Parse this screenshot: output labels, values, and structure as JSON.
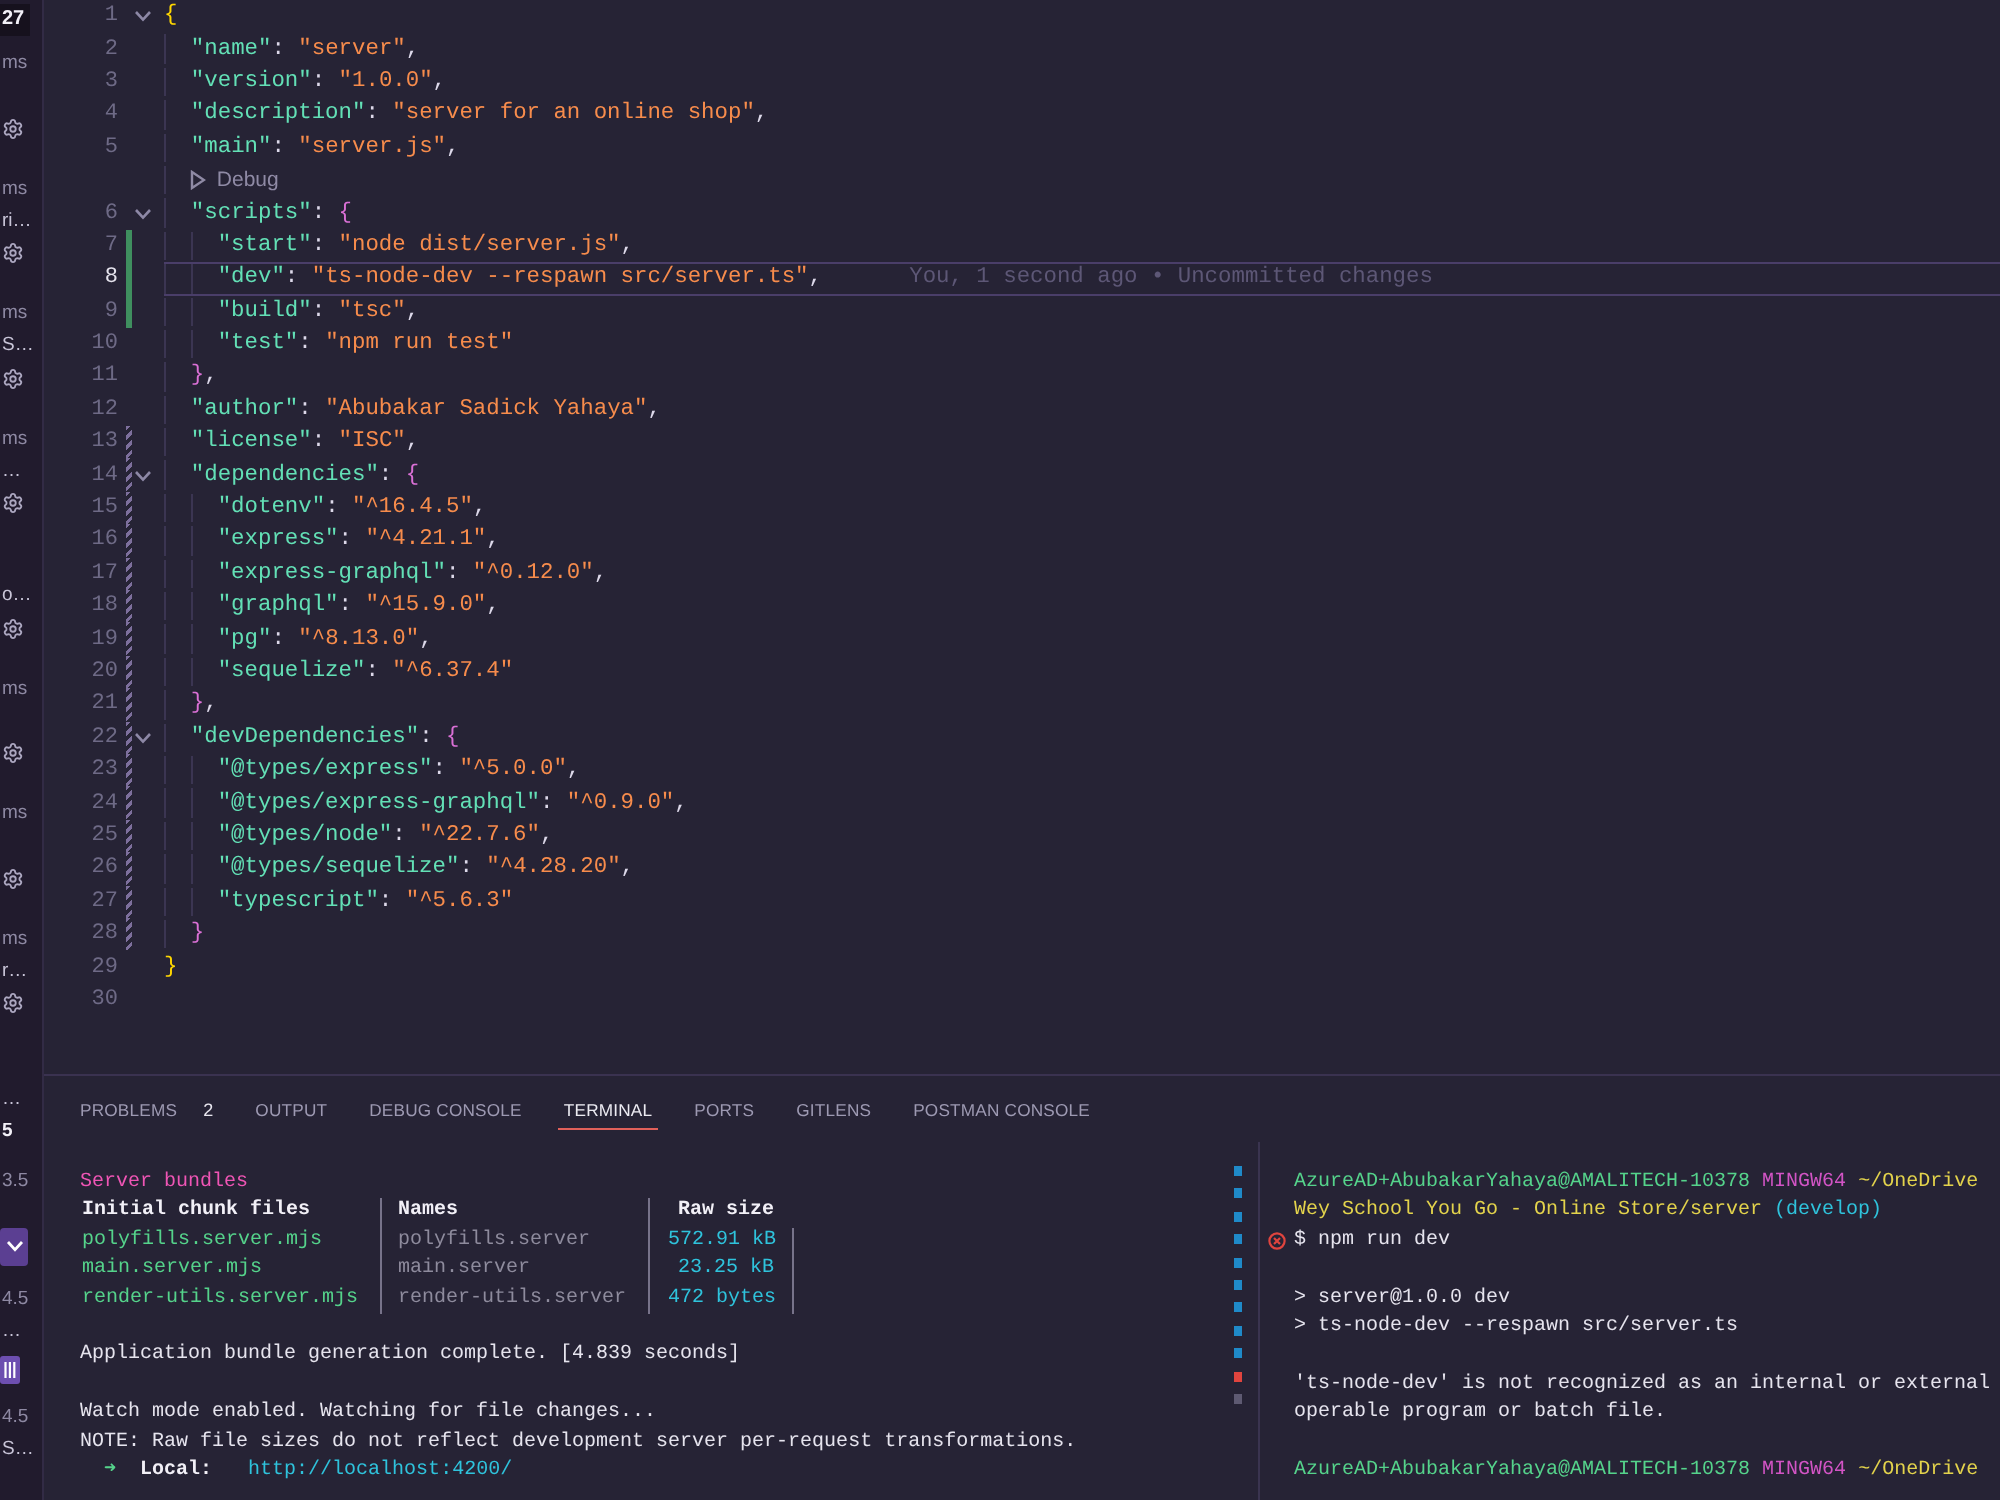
{
  "side_strip": {
    "count": "27",
    "groups": [
      {
        "time": "ms"
      },
      {
        "time": "ms",
        "label": "ri…"
      },
      {
        "time": "ms",
        "label": "S…"
      },
      {
        "time": "ms",
        "label": "…"
      },
      {
        "label": "o…"
      },
      {
        "time": "ms"
      },
      {
        "time": "ms"
      },
      {
        "time": "ms",
        "label": "r…"
      }
    ],
    "tail": [
      {
        "kind": "label",
        "text": "…"
      },
      {
        "kind": "count",
        "text": "5"
      },
      {
        "kind": "value",
        "text": "3.5"
      },
      {
        "kind": "chevron"
      },
      {
        "kind": "value",
        "text": "4.5"
      },
      {
        "kind": "label",
        "text": "…"
      },
      {
        "kind": "bars"
      },
      {
        "kind": "value",
        "text": "4.5"
      },
      {
        "kind": "label",
        "text": "S…"
      }
    ]
  },
  "editor": {
    "lines": [
      {
        "kind": "block",
        "number": "1",
        "current": false,
        "added": false,
        "modified": false,
        "expanded": true,
        "tokens": [
          {
            "kind": "bracket",
            "text": "{"
          }
        ],
        "children": [
          {
            "kind": "code",
            "number": "2",
            "current": false,
            "added": false,
            "modified": false,
            "tokens": [
              {
                "kind": "key",
                "text": "\"name\""
              },
              {
                "kind": "punct",
                "text": ": "
              },
              {
                "kind": "string",
                "text": "\"server\""
              },
              {
                "kind": "punct",
                "text": ","
              }
            ]
          },
          {
            "kind": "code",
            "number": "3",
            "current": false,
            "added": false,
            "modified": false,
            "tokens": [
              {
                "kind": "key",
                "text": "\"version\""
              },
              {
                "kind": "punct",
                "text": ": "
              },
              {
                "kind": "string",
                "text": "\"1.0.0\""
              },
              {
                "kind": "punct",
                "text": ","
              }
            ]
          },
          {
            "kind": "code",
            "number": "4",
            "current": false,
            "added": false,
            "modified": false,
            "tokens": [
              {
                "kind": "key",
                "text": "\"description\""
              },
              {
                "kind": "punct",
                "text": ": "
              },
              {
                "kind": "string",
                "text": "\"server for an online shop\""
              },
              {
                "kind": "punct",
                "text": ","
              }
            ]
          },
          {
            "kind": "code",
            "number": "5",
            "current": false,
            "added": false,
            "modified": false,
            "tokens": [
              {
                "kind": "key",
                "text": "\"main\""
              },
              {
                "kind": "punct",
                "text": ": "
              },
              {
                "kind": "string",
                "text": "\"server.js\""
              },
              {
                "kind": "punct",
                "text": ","
              }
            ]
          },
          {
            "kind": "codelens",
            "label": "Debug"
          },
          {
            "kind": "block",
            "number": "6",
            "current": false,
            "added": false,
            "modified": false,
            "expanded": true,
            "tokens": [
              {
                "kind": "key",
                "text": "\"scripts\""
              },
              {
                "kind": "punct",
                "text": ": "
              },
              {
                "kind": "bracket",
                "text": "{"
              }
            ],
            "children": [
              {
                "kind": "code",
                "number": "7",
                "current": false,
                "added": true,
                "modified": false,
                "tokens": [
                  {
                    "kind": "key",
                    "text": "\"start\""
                  },
                  {
                    "kind": "punct",
                    "text": ": "
                  },
                  {
                    "kind": "string",
                    "text": "\"node dist/server.js\""
                  },
                  {
                    "kind": "punct",
                    "text": ","
                  }
                ]
              },
              {
                "kind": "code",
                "number": "8",
                "current": true,
                "added": true,
                "modified": false,
                "blame": "You, 1 second ago • Uncommitted changes",
                "tokens": [
                  {
                    "kind": "key",
                    "text": "\"dev\""
                  },
                  {
                    "kind": "punct",
                    "text": ": "
                  },
                  {
                    "kind": "string",
                    "text": "\"ts-node-dev --respawn src/server.ts\""
                  },
                  {
                    "kind": "punct",
                    "text": ","
                  }
                ]
              },
              {
                "kind": "code",
                "number": "9",
                "current": false,
                "added": true,
                "modified": false,
                "tokens": [
                  {
                    "kind": "key",
                    "text": "\"build\""
                  },
                  {
                    "kind": "punct",
                    "text": ": "
                  },
                  {
                    "kind": "string",
                    "text": "\"tsc\""
                  },
                  {
                    "kind": "punct",
                    "text": ","
                  }
                ]
              },
              {
                "kind": "code",
                "number": "10",
                "current": false,
                "added": false,
                "modified": false,
                "tokens": [
                  {
                    "kind": "key",
                    "text": "\"test\""
                  },
                  {
                    "kind": "punct",
                    "text": ": "
                  },
                  {
                    "kind": "string",
                    "text": "\"npm run test\""
                  }
                ]
              }
            ]
          },
          {
            "kind": "code",
            "number": "11",
            "current": false,
            "added": false,
            "modified": false,
            "tokens": [
              {
                "kind": "bracket",
                "text": "}"
              },
              {
                "kind": "punct",
                "text": ","
              }
            ]
          },
          {
            "kind": "code",
            "number": "12",
            "current": false,
            "added": false,
            "modified": false,
            "tokens": [
              {
                "kind": "key",
                "text": "\"author\""
              },
              {
                "kind": "punct",
                "text": ": "
              },
              {
                "kind": "string",
                "text": "\"Abubakar Sadick Yahaya\""
              },
              {
                "kind": "punct",
                "text": ","
              }
            ]
          },
          {
            "kind": "code",
            "number": "13",
            "current": false,
            "added": false,
            "modified": true,
            "tokens": [
              {
                "kind": "key",
                "text": "\"license\""
              },
              {
                "kind": "punct",
                "text": ": "
              },
              {
                "kind": "string",
                "text": "\"ISC\""
              },
              {
                "kind": "punct",
                "text": ","
              }
            ]
          },
          {
            "kind": "block",
            "number": "14",
            "current": false,
            "added": false,
            "modified": true,
            "expanded": true,
            "tokens": [
              {
                "kind": "key",
                "text": "\"dependencies\""
              },
              {
                "kind": "punct",
                "text": ": "
              },
              {
                "kind": "bracket",
                "text": "{"
              }
            ],
            "children": [
              {
                "kind": "code",
                "number": "15",
                "current": false,
                "added": false,
                "modified": true,
                "tokens": [
                  {
                    "kind": "key",
                    "text": "\"dotenv\""
                  },
                  {
                    "kind": "punct",
                    "text": ": "
                  },
                  {
                    "kind": "string",
                    "text": "\"^16.4.5\""
                  },
                  {
                    "kind": "punct",
                    "text": ","
                  }
                ]
              },
              {
                "kind": "code",
                "number": "16",
                "current": false,
                "added": false,
                "modified": true,
                "tokens": [
                  {
                    "kind": "key",
                    "text": "\"express\""
                  },
                  {
                    "kind": "punct",
                    "text": ": "
                  },
                  {
                    "kind": "string",
                    "text": "\"^4.21.1\""
                  },
                  {
                    "kind": "punct",
                    "text": ","
                  }
                ]
              },
              {
                "kind": "code",
                "number": "17",
                "current": false,
                "added": false,
                "modified": true,
                "tokens": [
                  {
                    "kind": "key",
                    "text": "\"express-graphql\""
                  },
                  {
                    "kind": "punct",
                    "text": ": "
                  },
                  {
                    "kind": "string",
                    "text": "\"^0.12.0\""
                  },
                  {
                    "kind": "punct",
                    "text": ","
                  }
                ]
              },
              {
                "kind": "code",
                "number": "18",
                "current": false,
                "added": false,
                "modified": true,
                "tokens": [
                  {
                    "kind": "key",
                    "text": "\"graphql\""
                  },
                  {
                    "kind": "punct",
                    "text": ": "
                  },
                  {
                    "kind": "string",
                    "text": "\"^15.9.0\""
                  },
                  {
                    "kind": "punct",
                    "text": ","
                  }
                ]
              },
              {
                "kind": "code",
                "number": "19",
                "current": false,
                "added": false,
                "modified": true,
                "tokens": [
                  {
                    "kind": "key",
                    "text": "\"pg\""
                  },
                  {
                    "kind": "punct",
                    "text": ": "
                  },
                  {
                    "kind": "string",
                    "text": "\"^8.13.0\""
                  },
                  {
                    "kind": "punct",
                    "text": ","
                  }
                ]
              },
              {
                "kind": "code",
                "number": "20",
                "current": false,
                "added": false,
                "modified": true,
                "tokens": [
                  {
                    "kind": "key",
                    "text": "\"sequelize\""
                  },
                  {
                    "kind": "punct",
                    "text": ": "
                  },
                  {
                    "kind": "string",
                    "text": "\"^6.37.4\""
                  }
                ]
              }
            ]
          },
          {
            "kind": "code",
            "number": "21",
            "current": false,
            "added": false,
            "modified": true,
            "tokens": [
              {
                "kind": "bracket",
                "text": "}"
              },
              {
                "kind": "punct",
                "text": ","
              }
            ]
          },
          {
            "kind": "block",
            "number": "22",
            "current": false,
            "added": false,
            "modified": true,
            "expanded": true,
            "tokens": [
              {
                "kind": "key",
                "text": "\"devDependencies\""
              },
              {
                "kind": "punct",
                "text": ": "
              },
              {
                "kind": "bracket",
                "text": "{"
              }
            ],
            "children": [
              {
                "kind": "code",
                "number": "23",
                "current": false,
                "added": false,
                "modified": true,
                "tokens": [
                  {
                    "kind": "key",
                    "text": "\"@types/express\""
                  },
                  {
                    "kind": "punct",
                    "text": ": "
                  },
                  {
                    "kind": "string",
                    "text": "\"^5.0.0\""
                  },
                  {
                    "kind": "punct",
                    "text": ","
                  }
                ]
              },
              {
                "kind": "code",
                "number": "24",
                "current": false,
                "added": false,
                "modified": true,
                "tokens": [
                  {
                    "kind": "key",
                    "text": "\"@types/express-graphql\""
                  },
                  {
                    "kind": "punct",
                    "text": ": "
                  },
                  {
                    "kind": "string",
                    "text": "\"^0.9.0\""
                  },
                  {
                    "kind": "punct",
                    "text": ","
                  }
                ]
              },
              {
                "kind": "code",
                "number": "25",
                "current": false,
                "added": false,
                "modified": true,
                "tokens": [
                  {
                    "kind": "key",
                    "text": "\"@types/node\""
                  },
                  {
                    "kind": "punct",
                    "text": ": "
                  },
                  {
                    "kind": "string",
                    "text": "\"^22.7.6\""
                  },
                  {
                    "kind": "punct",
                    "text": ","
                  }
                ]
              },
              {
                "kind": "code",
                "number": "26",
                "current": false,
                "added": false,
                "modified": true,
                "tokens": [
                  {
                    "kind": "key",
                    "text": "\"@types/sequelize\""
                  },
                  {
                    "kind": "punct",
                    "text": ": "
                  },
                  {
                    "kind": "string",
                    "text": "\"^4.28.20\""
                  },
                  {
                    "kind": "punct",
                    "text": ","
                  }
                ]
              },
              {
                "kind": "code",
                "number": "27",
                "current": false,
                "added": false,
                "modified": true,
                "tokens": [
                  {
                    "kind": "key",
                    "text": "\"typescript\""
                  },
                  {
                    "kind": "punct",
                    "text": ": "
                  },
                  {
                    "kind": "string",
                    "text": "\"^5.6.3\""
                  }
                ]
              }
            ]
          },
          {
            "kind": "code",
            "number": "28",
            "current": false,
            "added": false,
            "modified": true,
            "tokens": [
              {
                "kind": "bracket",
                "text": "}"
              }
            ]
          }
        ]
      },
      {
        "kind": "code",
        "number": "29",
        "current": false,
        "added": false,
        "modified": false,
        "tokens": [
          {
            "kind": "bracket",
            "text": "}"
          }
        ]
      },
      {
        "kind": "code",
        "number": "30",
        "current": false,
        "added": false,
        "modified": false
      }
    ]
  },
  "panel": {
    "tabs": [
      {
        "label": "PROBLEMS",
        "count": "2",
        "selected": false
      },
      {
        "label": "OUTPUT",
        "selected": false
      },
      {
        "label": "DEBUG CONSOLE",
        "selected": false
      },
      {
        "label": "TERMINAL",
        "selected": true
      },
      {
        "label": "PORTS",
        "selected": false
      },
      {
        "label": "GITLENS",
        "selected": false
      },
      {
        "label": "POSTMAN CONSOLE",
        "selected": false
      }
    ],
    "terminal_left": {
      "paragraphs": [
        [
          {
            "kind": "heading",
            "text": "Server bundles"
          },
          {
            "kind": "table",
            "columns": [
              {
                "kind": "file",
                "label": "Initial chunk files"
              },
              {
                "kind": "name",
                "label": "Names"
              },
              {
                "kind": "size",
                "label": "Raw size"
              }
            ],
            "rows": [
              [
                "polyfills.server.mjs",
                "polyfills.server",
                "572.91 kB"
              ],
              [
                "main.server.mjs",
                "main.server",
                "23.25 kB"
              ],
              [
                "render-utils.server.mjs",
                "render-utils.server",
                "472 bytes"
              ]
            ]
          }
        ],
        [
          {
            "kind": "text",
            "text": "Application bundle generation complete. [4.839 seconds]"
          }
        ],
        [
          {
            "kind": "text",
            "text": "Watch mode enabled. Watching for file changes..."
          },
          {
            "kind": "text",
            "text": "NOTE: Raw file sizes do not reflect development server per-request transformations."
          },
          {
            "kind": "server_url",
            "arrow": "➜",
            "label": "Local:",
            "url": "http://localhost:4200/"
          }
        ]
      ]
    },
    "overview_marks": [
      {
        "color": "#1f8ac9"
      },
      {
        "color": "#1f8ac9"
      },
      {
        "color": "#1f8ac9"
      },
      {
        "color": "#1f8ac9"
      },
      {
        "color": "#1f8ac9"
      },
      {
        "color": "#1f8ac9"
      },
      {
        "color": "#1f8ac9"
      },
      {
        "color": "#1f8ac9"
      },
      {
        "color": "#1f8ac9"
      },
      {
        "color": "#e0443e"
      },
      {
        "color": "#5e5a72"
      }
    ],
    "terminal_right": {
      "paragraphs": [
        [
          {
            "kind": "prompt",
            "segments": [
              {
                "kind": "user",
                "text": "AzureAD+AbubakarYahaya@AMALITECH-10378"
              },
              {
                "kind": "shell",
                "text": "MINGW64"
              },
              {
                "kind": "path",
                "text": "~/OneDrive"
              }
            ]
          },
          {
            "kind": "prompt",
            "segments": [
              {
                "kind": "path",
                "text": "Wey School You Go - Online Store/server"
              },
              {
                "kind": "branch",
                "text": "(develop)"
              }
            ]
          },
          {
            "kind": "command",
            "failed": true,
            "text": "$ npm run dev"
          }
        ],
        [
          {
            "kind": "text",
            "text": "> server@1.0.0 dev"
          },
          {
            "kind": "text",
            "text": "> ts-node-dev --respawn src/server.ts"
          }
        ],
        [
          {
            "kind": "text",
            "text": "'ts-node-dev' is not recognized as an internal or external"
          },
          {
            "kind": "text",
            "text": "operable program or batch file."
          }
        ],
        [
          {
            "kind": "prompt",
            "segments": [
              {
                "kind": "user",
                "text": "AzureAD+AbubakarYahaya@AMALITECH-10378"
              },
              {
                "kind": "shell",
                "text": "MINGW64"
              },
              {
                "kind": "path",
                "text": "~/OneDrive"
              }
            ]
          }
        ]
      ]
    }
  }
}
